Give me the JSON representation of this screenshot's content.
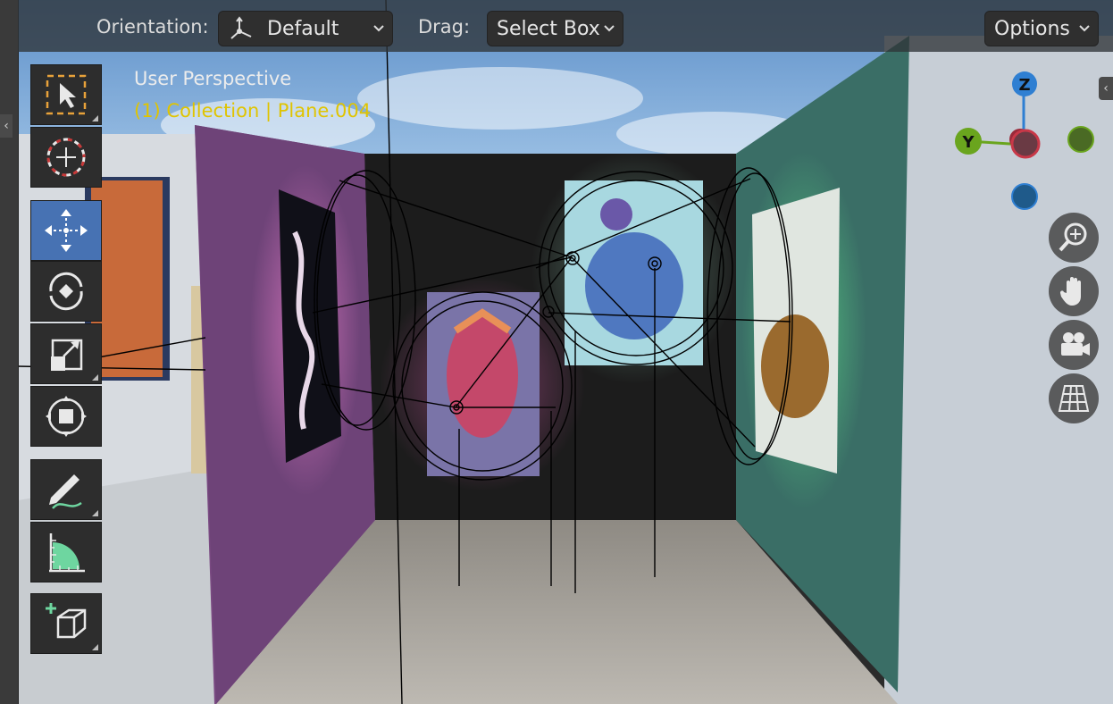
{
  "header": {
    "orientation_label": "Orientation:",
    "orientation_value": "Default",
    "drag_label": "Drag:",
    "drag_value": "Select Box",
    "options_label": "Options"
  },
  "overlay": {
    "view_name": "User Perspective",
    "context": "(1) Collection | Plane.004"
  },
  "gizmo": {
    "z_label": "Z",
    "y_label": "Y",
    "x_color": "#c83848",
    "y_color": "#6aa51e",
    "z_color": "#2f7fd2"
  },
  "toolbar": {
    "tools": [
      {
        "name": "select-box",
        "icon": "select-box-icon",
        "active": false
      },
      {
        "name": "cursor",
        "icon": "cursor-icon",
        "active": false
      },
      {
        "name": "move",
        "icon": "move-icon",
        "active": true
      },
      {
        "name": "rotate",
        "icon": "rotate-icon",
        "active": false
      },
      {
        "name": "scale",
        "icon": "scale-icon",
        "active": false
      },
      {
        "name": "transform",
        "icon": "transform-icon",
        "active": false
      },
      {
        "name": "annotate",
        "icon": "annotate-icon",
        "active": false
      },
      {
        "name": "measure",
        "icon": "measure-icon",
        "active": false
      },
      {
        "name": "add-cube",
        "icon": "add-cube-icon",
        "active": false
      }
    ]
  },
  "navigation": {
    "buttons": [
      "zoom-icon",
      "pan-hand-icon",
      "camera-icon",
      "grid-ortho-icon"
    ]
  },
  "colors": {
    "accent": "#4772b3",
    "selection_text": "#e0c400"
  }
}
